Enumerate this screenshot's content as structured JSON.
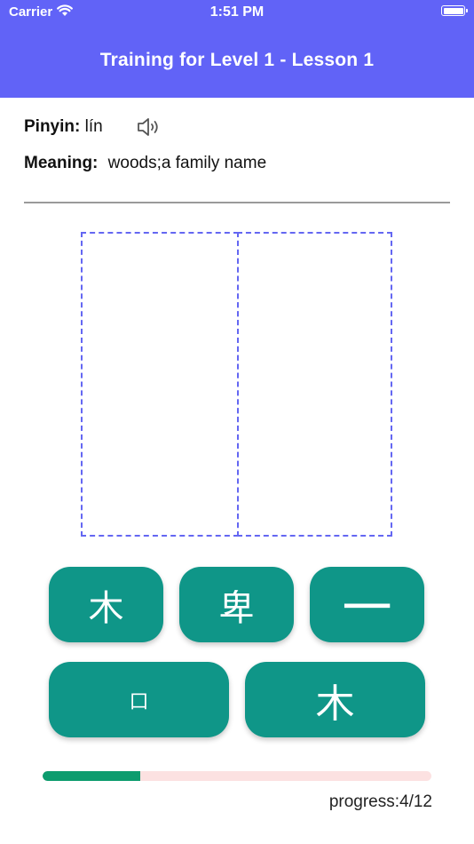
{
  "status_bar": {
    "carrier": "Carrier",
    "time": "1:51 PM"
  },
  "header": {
    "title": "Training for Level 1 - Lesson 1",
    "bg_color": "#6163f7"
  },
  "word": {
    "pinyin_label": "Pinyin:",
    "pinyin": "lín",
    "meaning_label": "Meaning:",
    "meaning": "woods;a family name",
    "audio_icon": "speaker-icon"
  },
  "tiles": [
    {
      "char": "木"
    },
    {
      "char": "卑"
    },
    {
      "char": "一"
    },
    {
      "char": "口"
    },
    {
      "char": "木"
    }
  ],
  "colors": {
    "tile": "#0f9688",
    "slot_border": "#6467f2",
    "progress_fill": "#0d9c6e",
    "progress_track": "#fce1e1"
  },
  "progress": {
    "current": 4,
    "total": 12,
    "text": "progress:4/12",
    "fraction": 0.25
  }
}
